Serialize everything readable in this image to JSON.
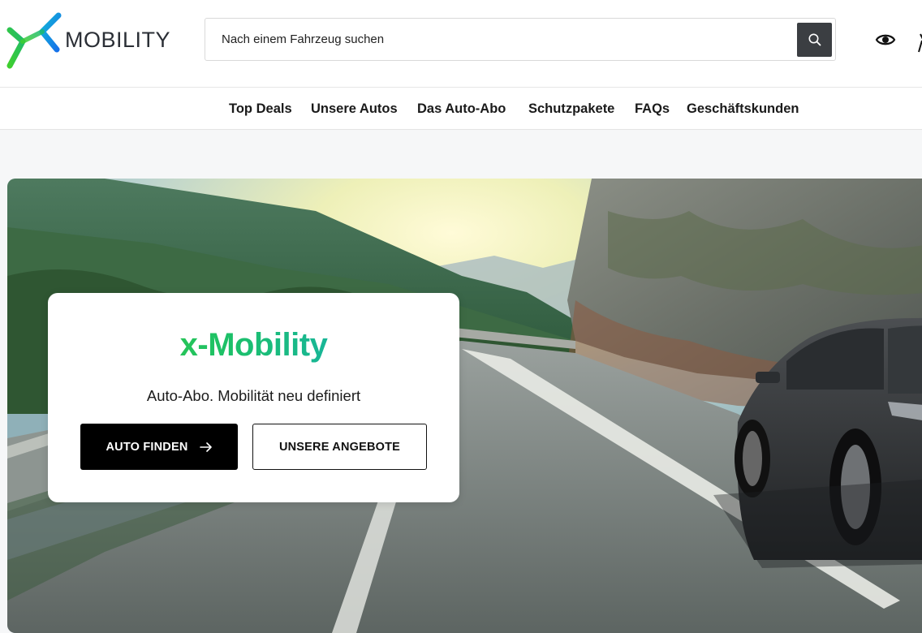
{
  "brand": {
    "logo_text": "MOBILITY",
    "colors": {
      "green": "#3fcf2f",
      "blue": "#1690e8"
    }
  },
  "search": {
    "placeholder": "Nach einem Fahrzeug suchen",
    "button_icon": "search-icon"
  },
  "header_icons": [
    "eye-icon",
    "partial-icon"
  ],
  "nav": {
    "items": [
      {
        "label": "Top Deals"
      },
      {
        "label": "Unsere Autos"
      },
      {
        "label": "Das Auto-Abo"
      },
      {
        "label": "Schutzpakete"
      },
      {
        "label": "FAQs"
      },
      {
        "label": "Geschäftskunden"
      }
    ]
  },
  "hero": {
    "title": "x-Mobility",
    "subtitle": "Auto-Abo. Mobilität neu definiert",
    "primary_button": "AUTO FINDEN",
    "primary_icon": "arrow-right-icon",
    "secondary_button": "UNSERE ANGEBOTE"
  }
}
